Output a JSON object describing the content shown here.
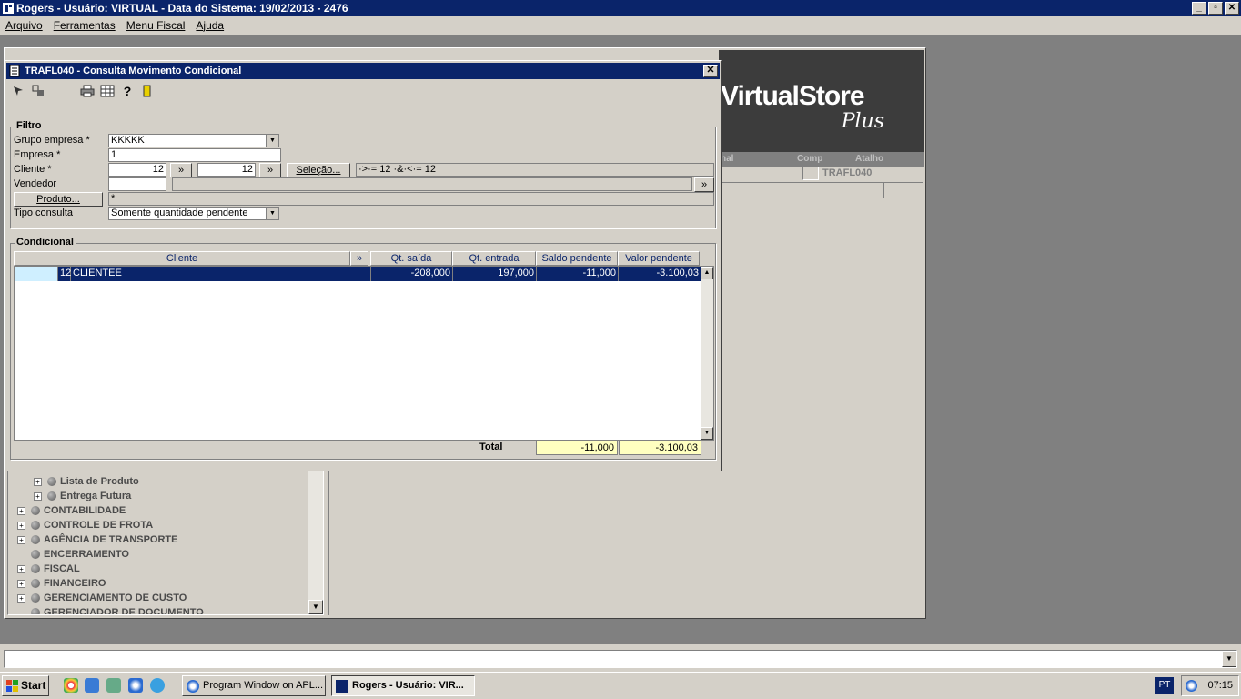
{
  "app": {
    "title": "Rogers - Usuário: VIRTUAL - Data do Sistema: 19/02/2013 - 2476",
    "window_buttons": [
      "_",
      "▫",
      "✕"
    ]
  },
  "menu": [
    "Arquivo",
    "Ferramentas",
    "Menu Fiscal",
    "Ajuda"
  ],
  "mdi": {
    "brand": "VirtualStore",
    "brand_sub": "Plus",
    "strip": [
      "nal",
      "Comp",
      "Atalho"
    ],
    "code": "TRAFL040"
  },
  "dialog": {
    "title": "TRAFL040 - Consulta Movimento Condicional",
    "toolbar_icons": [
      "select-icon",
      "refresh-icon",
      "print-icon",
      "grid-icon",
      "help-icon",
      "exit-icon"
    ],
    "filter": {
      "legend": "Filtro",
      "grupo_label": "Grupo empresa *",
      "grupo_value": "KKKKK",
      "empresa_label": "Empresa *",
      "empresa_value": "1",
      "cliente_label": "Cliente *",
      "cliente_from": "12",
      "cliente_to": "12",
      "more": "»",
      "selecao_label": "Seleção...",
      "cliente_expr": "·>·= 12 ·&·<·= 12",
      "vendedor_label": "Vendedor",
      "vendedor_value": "",
      "produto_label": "Produto...",
      "produto_value": "*",
      "tipo_label": "Tipo consulta",
      "tipo_value": "Somente quantidade pendente"
    },
    "grid": {
      "legend": "Condicional",
      "headers": [
        "Cliente",
        "»",
        "Qt. saída",
        "Qt. entrada",
        "Saldo pendente",
        "Valor pendente"
      ],
      "rows": [
        {
          "code": "12",
          "name": "CLIENTEE",
          "saida": "-208,000",
          "entrada": "197,000",
          "saldo": "-11,000",
          "valor": "-3.100,03"
        }
      ],
      "total_label": "Total",
      "total_saldo": "-11,000",
      "total_valor": "-3.100,03"
    }
  },
  "tree": [
    {
      "label": "Lista de Produto",
      "expand": "+",
      "level": 1
    },
    {
      "label": "Entrega Futura",
      "expand": "+",
      "level": 1
    },
    {
      "label": "CONTABILIDADE",
      "expand": "+",
      "level": 0
    },
    {
      "label": "CONTROLE DE FROTA",
      "expand": "+",
      "level": 0
    },
    {
      "label": "AGÊNCIA DE TRANSPORTE",
      "expand": "+",
      "level": 0
    },
    {
      "label": "ENCERRAMENTO",
      "expand": "",
      "level": 0
    },
    {
      "label": "FISCAL",
      "expand": "+",
      "level": 0
    },
    {
      "label": "FINANCEIRO",
      "expand": "+",
      "level": 0
    },
    {
      "label": "GERENCIAMENTO DE CUSTO",
      "expand": "+",
      "level": 0
    },
    {
      "label": "GERENCIADOR DE DOCUMENTO",
      "expand": "",
      "level": 0
    }
  ],
  "taskbar": {
    "start": "Start",
    "tasks": [
      "Program Window on APL...",
      "Rogers - Usuário: VIR..."
    ],
    "lang": "PT",
    "clock": "07:15"
  }
}
